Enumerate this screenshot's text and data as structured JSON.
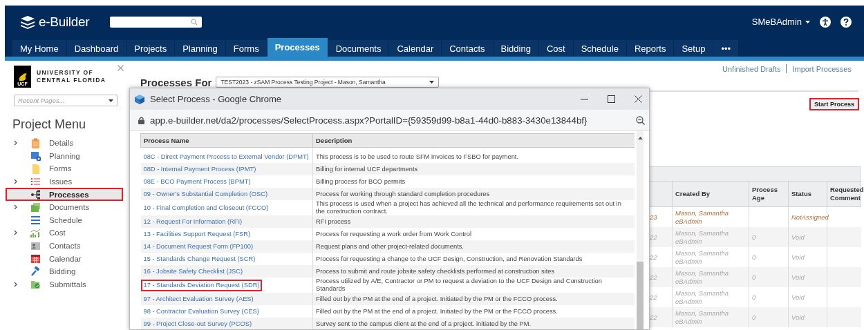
{
  "header": {
    "logo": "e-Builder",
    "user": "SMeBAdmin"
  },
  "tabs": [
    {
      "label": "My Home",
      "selected": false
    },
    {
      "label": "Dashboard",
      "selected": false
    },
    {
      "label": "Projects",
      "selected": false
    },
    {
      "label": "Planning",
      "selected": false
    },
    {
      "label": "Forms",
      "selected": false
    },
    {
      "label": "Processes",
      "selected": true
    },
    {
      "label": "Documents",
      "selected": false
    },
    {
      "label": "Calendar",
      "selected": false
    },
    {
      "label": "Contacts",
      "selected": false
    },
    {
      "label": "Bidding",
      "selected": false
    },
    {
      "label": "Cost",
      "selected": false
    },
    {
      "label": "Schedule",
      "selected": false
    },
    {
      "label": "Reports",
      "selected": false
    },
    {
      "label": "Setup",
      "selected": false
    },
    {
      "label": "•••",
      "selected": false
    }
  ],
  "sidebar": {
    "logo": {
      "badge": "UCF",
      "line_1": "UNIVERSITY OF",
      "line_2": "CENTRAL FLORIDA"
    },
    "recent_pages": {
      "placeholder": "Recent Pages..."
    },
    "title": "Project Menu",
    "items": [
      {
        "label": "Details",
        "expandable": true,
        "selected": false,
        "highlighted": false
      },
      {
        "label": "Planning",
        "expandable": false,
        "selected": false,
        "highlighted": false
      },
      {
        "label": "Forms",
        "expandable": false,
        "selected": false,
        "highlighted": false
      },
      {
        "label": "Issues",
        "expandable": true,
        "selected": false,
        "highlighted": false
      },
      {
        "label": "Processes",
        "expandable": false,
        "selected": true,
        "highlighted": true
      },
      {
        "label": "Documents",
        "expandable": true,
        "selected": false,
        "highlighted": false
      },
      {
        "label": "Schedule",
        "expandable": false,
        "selected": false,
        "highlighted": false
      },
      {
        "label": "Cost",
        "expandable": true,
        "selected": false,
        "highlighted": false
      },
      {
        "label": "Contacts",
        "expandable": false,
        "selected": false,
        "highlighted": false
      },
      {
        "label": "Calendar",
        "expandable": false,
        "selected": false,
        "highlighted": false
      },
      {
        "label": "Bidding",
        "expandable": false,
        "selected": false,
        "highlighted": false
      },
      {
        "label": "Submittals",
        "expandable": true,
        "selected": false,
        "highlighted": false
      }
    ]
  },
  "main": {
    "heading": "Processes For",
    "project_select": "TEST2023 - zSAM Process Testing Project - Mason, Samantha",
    "links": [
      "Unfinished Drafts",
      "Import Processes"
    ],
    "start_button": {
      "label": "Start Process",
      "highlighted": true
    },
    "table": {
      "columns": [
        "Created By",
        "Process Age",
        "Status",
        "Requested Comment"
      ],
      "rows": [
        {
          "column_1": "23",
          "created_by": "Mason, Samantha",
          "created_by_role": "eBAdmin",
          "status": "NotAssigned",
          "kind": "active"
        },
        {
          "column_1": "22",
          "created_by": "Mason, Samantha",
          "created_by_role": "eBAdmin",
          "process_age": "0",
          "status": "Void",
          "kind": "void"
        },
        {
          "column_1": "22",
          "created_by": "Mason, Samantha",
          "created_by_role": "eBAdmin",
          "process_age": "0",
          "status": "Void",
          "kind": "void"
        },
        {
          "column_1": "22",
          "created_by": "Mason, Samantha",
          "created_by_role": "eBAdmin",
          "process_age": "0",
          "status": "Void",
          "kind": "void"
        },
        {
          "column_1": "22",
          "created_by": "Mason, Samantha",
          "created_by_role": "eBAdmin",
          "process_age": "0",
          "status": "Void",
          "kind": "void"
        },
        {
          "column_1": "22",
          "created_by": "Mason, Samantha",
          "created_by_role": "eBAdmin",
          "process_age": "0",
          "status": "Void",
          "kind": "void"
        }
      ]
    }
  },
  "popup": {
    "title": "Select Process - Google Chrome",
    "url": "app.e-builder.net/da2/processes/SelectProcess.aspx?PortalID={59359d99-b8a1-44d0-b883-3430e13844bf}",
    "columns": [
      "Process Name",
      "Description"
    ],
    "rows": [
      {
        "name": "08C - Direct Payment Process to External Vendor (DPMT)",
        "description": "This process is to be used to route SFM invoices to FSBO for payment.",
        "highlighted": false
      },
      {
        "name": "08D - Internal Payment Process (IPMT)",
        "description": "Billing for internal UCF departments",
        "highlighted": false
      },
      {
        "name": "08E - BCO Payment Process (BPMT)",
        "description": "Billing process for BCO permits",
        "highlighted": false
      },
      {
        "name": "09 - Owner's Substantial Completion (OSC)",
        "description": "Process for working through standard completion procedures",
        "highlighted": false
      },
      {
        "name": "10 - Final Completion and Closeout (FCCO)",
        "description": "This process is used when a project has achieved all the technical and performance requirements set out in the construction contract.",
        "highlighted": false
      },
      {
        "name": "12 - Request For Information (RFI)",
        "description": "RFI process",
        "highlighted": false
      },
      {
        "name": "13 - Facilities Support Request (FSR)",
        "description": "Process for requesting a work order from Work Control",
        "highlighted": false
      },
      {
        "name": "14 - Document Request Form (FP100)",
        "description": "Request plans and other project-related documents.",
        "highlighted": false
      },
      {
        "name": "15 - Standards Change Request (SCR)",
        "description": "Process for requesting a change to the UCF Design, Construction, and Renovation Standards",
        "highlighted": false
      },
      {
        "name": "16 - Jobsite Safety Checklist (JSC)",
        "description": "Process to submit and route jobsite safety checklists performed at construction sites",
        "highlighted": false
      },
      {
        "name": "17 - Standards Deviation Request (SDR)",
        "description": "Process utilized by A/E, Contractor or PM to request a deviation to the UCF Design and Construction Standards",
        "highlighted": true
      },
      {
        "name": "97 - Architect Evaluation Survey (AES)",
        "description": "Filled out by the PM at the end of a project. Initiated by the PM or the FCCO process.",
        "highlighted": false
      },
      {
        "name": "98 - Contractor Evaluation Survey (CES)",
        "description": "Filled out by the PM at the end of a project. Initiated by the PM or the FCCO process.",
        "highlighted": false
      },
      {
        "name": "99 - Project Close-out Survey (PCOS)",
        "description": "Survey sent to the campus client at the end of a project. initiated by the PM.",
        "highlighted": false
      }
    ]
  }
}
